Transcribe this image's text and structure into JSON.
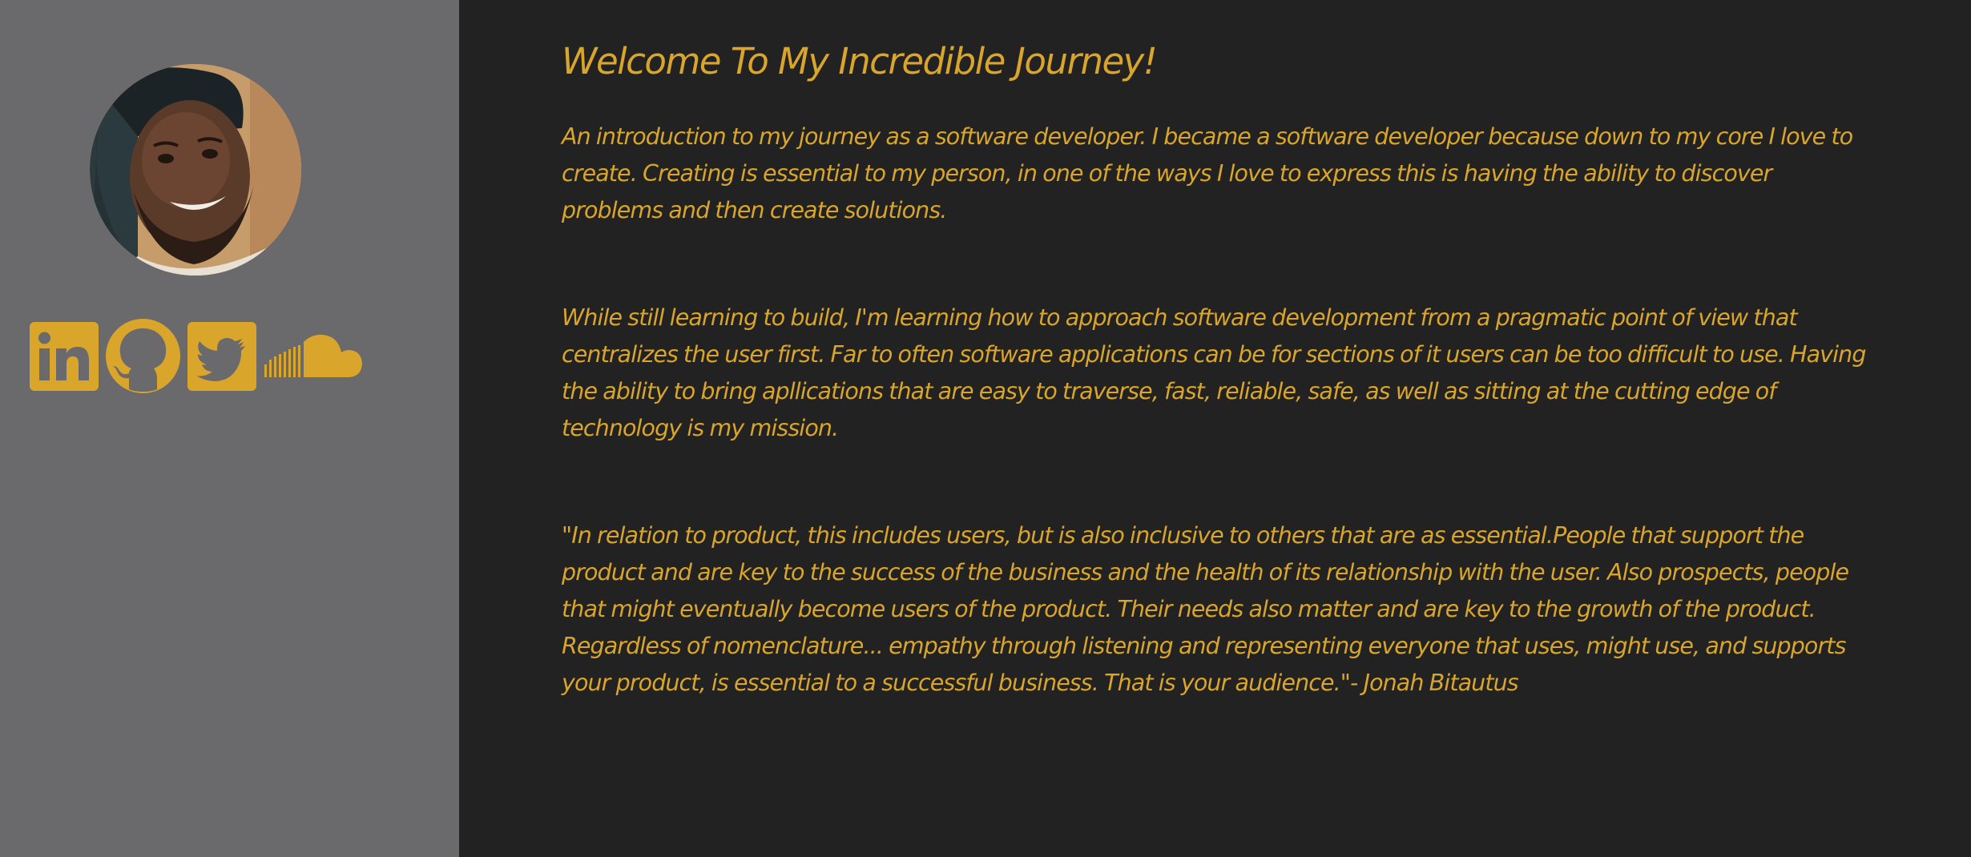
{
  "profile": {
    "avatar_icon": "profile-photo",
    "social_links": [
      {
        "name": "linkedin",
        "icon": "linkedin-icon"
      },
      {
        "name": "github",
        "icon": "github-icon"
      },
      {
        "name": "twitter",
        "icon": "twitter-icon"
      },
      {
        "name": "soundcloud",
        "icon": "soundcloud-icon"
      }
    ]
  },
  "main": {
    "title": "Welcome To My Incredible Journey!",
    "paragraphs": [
      "An introduction to my journey as a software developer. I became a software developer because down to my core I love to create. Creating is essential to my person, in one of the ways I love to express this is having the ability to discover problems and then create solutions.",
      "While still learning to build, I'm learning how to approach software development from a pragmatic point of view that centralizes the user first. Far to often software applications can be for sections of it users can be too difficult to use. Having the ability to bring apllications that are easy to traverse, fast, reliable, safe, as well as sitting at the cutting edge of technology is my mission.",
      "\"In relation to product, this includes users, but is also inclusive to others that are as essential.People that support the product and are key to the success of the business and the health of its relationship with the user. Also prospects, people that might eventually become users of the product. Their needs also matter and are key to the growth of the product. Regardless of nomenclature... empathy through listening and representing everyone that uses, might use, and supports your product, is essential to a successful business. That is your audience.\"- Jonah Bitautus"
    ]
  },
  "colors": {
    "accent": "#d9a52a",
    "sidebar_bg": "#6a696b",
    "main_bg": "#222222"
  }
}
